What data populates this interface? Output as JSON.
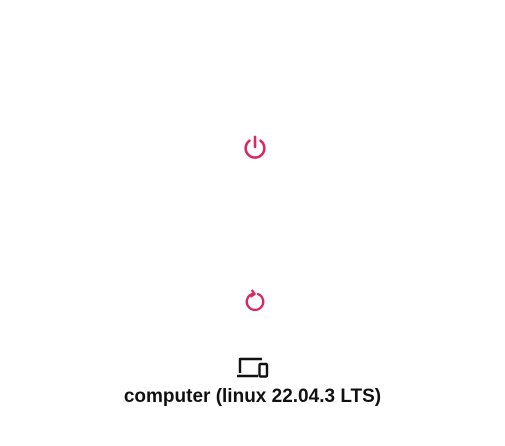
{
  "controls": {
    "power": {
      "icon": "power-icon"
    },
    "restart": {
      "icon": "restart-icon"
    }
  },
  "device": {
    "icon": "devices-icon",
    "label": "computer (linux 22.04.3 LTS)"
  },
  "colors": {
    "accent": "#d92763",
    "text": "#111111",
    "background": "#ffffff"
  }
}
